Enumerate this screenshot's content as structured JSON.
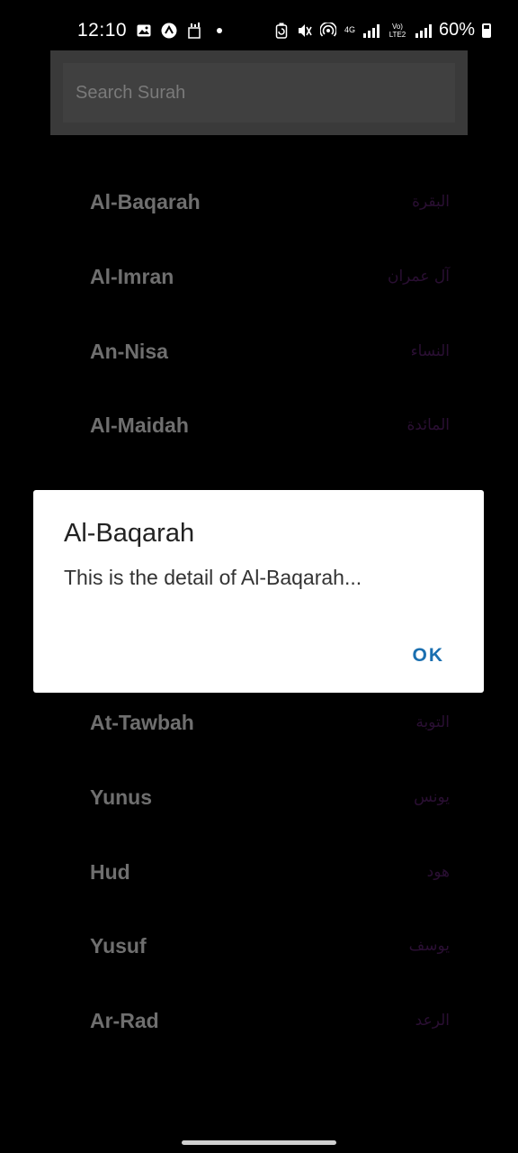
{
  "status_bar": {
    "time": "12:10",
    "battery": "60%",
    "network_label": "4G",
    "volte_label": "Vo) LTE2",
    "left_icons": [
      "gallery-icon",
      "app-icon",
      "sim-icon",
      "dot-icon"
    ],
    "right_icons": [
      "battery-saver-icon",
      "mute-icon",
      "hotspot-icon",
      "signal-icon",
      "signal-icon",
      "battery-icon"
    ]
  },
  "search": {
    "placeholder": "Search Surah"
  },
  "surah_list": [
    {
      "name": "Al-Baqarah",
      "arabic": "البقرة"
    },
    {
      "name": "Al-Imran",
      "arabic": "آل عمران"
    },
    {
      "name": "An-Nisa",
      "arabic": "النساء"
    },
    {
      "name": "Al-Maidah",
      "arabic": "المائدة"
    },
    {
      "name": "At-Tawbah",
      "arabic": "التوبة"
    },
    {
      "name": "Yunus",
      "arabic": "يونس"
    },
    {
      "name": "Hud",
      "arabic": "هود"
    },
    {
      "name": "Yusuf",
      "arabic": "يوسف"
    },
    {
      "name": "Ar-Rad",
      "arabic": "الرعد"
    }
  ],
  "dialog": {
    "title": "Al-Baqarah",
    "body": "This is the detail of Al-Baqarah...",
    "ok_label": "OK"
  },
  "colors": {
    "background": "#000000",
    "list_text": "#6f6f6f",
    "arabic_text": "#2a0f33",
    "dialog_accent": "#1a6fb0"
  }
}
